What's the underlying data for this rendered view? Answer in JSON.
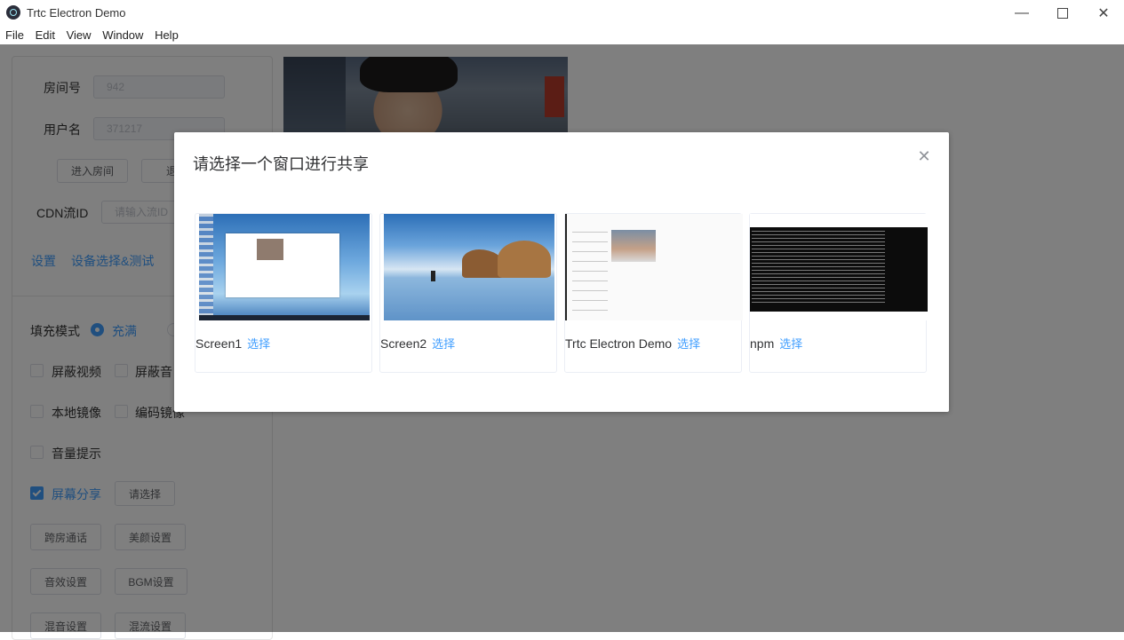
{
  "window": {
    "title": "Trtc Electron Demo"
  },
  "menu": [
    "File",
    "Edit",
    "View",
    "Window",
    "Help"
  ],
  "form": {
    "room_label": "房间号",
    "room_value": "942",
    "user_label": "用户名",
    "user_value": "371217",
    "enter_room": "进入房间",
    "exit_room": "退出",
    "cdn_label": "CDN流ID",
    "cdn_placeholder": "请输入流ID",
    "settings_link": "设置",
    "device_link": "设备选择&测试"
  },
  "options": {
    "fill_mode_label": "填充模式",
    "fill_mode_selected": "充满",
    "mute_video": "屏蔽视频",
    "mute_audio": "屏蔽音",
    "local_mirror": "本地镜像",
    "encode_mirror": "编码镜像",
    "volume_tip": "音量提示",
    "screen_share": "屏幕分享",
    "screen_share_checked": true,
    "choose_button": "请选择",
    "cross_room": "跨房通话",
    "beauty": "美颜设置",
    "audio_effect": "音效设置",
    "bgm": "BGM设置",
    "mix": "混音设置",
    "stream_mix": "混流设置"
  },
  "dialog": {
    "title": "请选择一个窗口进行共享",
    "select_label": "选择",
    "sources": [
      {
        "name": "Screen1"
      },
      {
        "name": "Screen2"
      },
      {
        "name": "Trtc Electron Demo"
      },
      {
        "name": "npm"
      }
    ]
  }
}
